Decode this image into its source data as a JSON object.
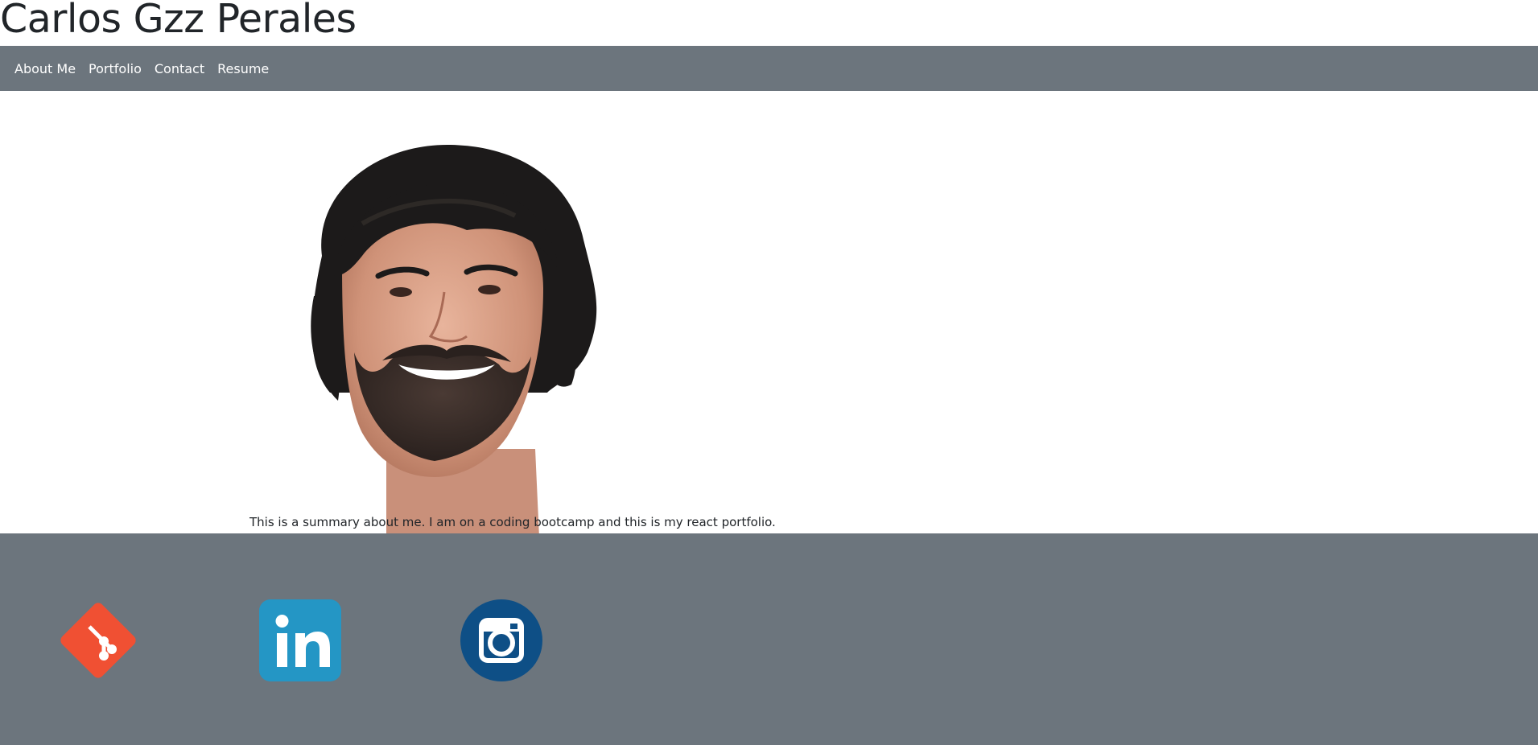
{
  "header": {
    "title": "Carlos Gzz Perales"
  },
  "nav": {
    "items": [
      {
        "label": "About Me"
      },
      {
        "label": "Portfolio"
      },
      {
        "label": "Contact"
      },
      {
        "label": "Resume"
      }
    ]
  },
  "about": {
    "photo_alt": "profile photo",
    "summary": "This is a summary about me. I am on a coding bootcamp and this is my react portfolio."
  },
  "footer": {
    "links": [
      {
        "icon": "git-icon",
        "color": "#f05033"
      },
      {
        "icon": "linkedin-icon",
        "color": "#2496c5"
      },
      {
        "icon": "instagram-icon",
        "color": "#0e4f86"
      }
    ]
  },
  "colors": {
    "navbar": "#6c757d",
    "footer": "#6c757d",
    "text": "#212529",
    "nav_text": "#ffffff"
  }
}
